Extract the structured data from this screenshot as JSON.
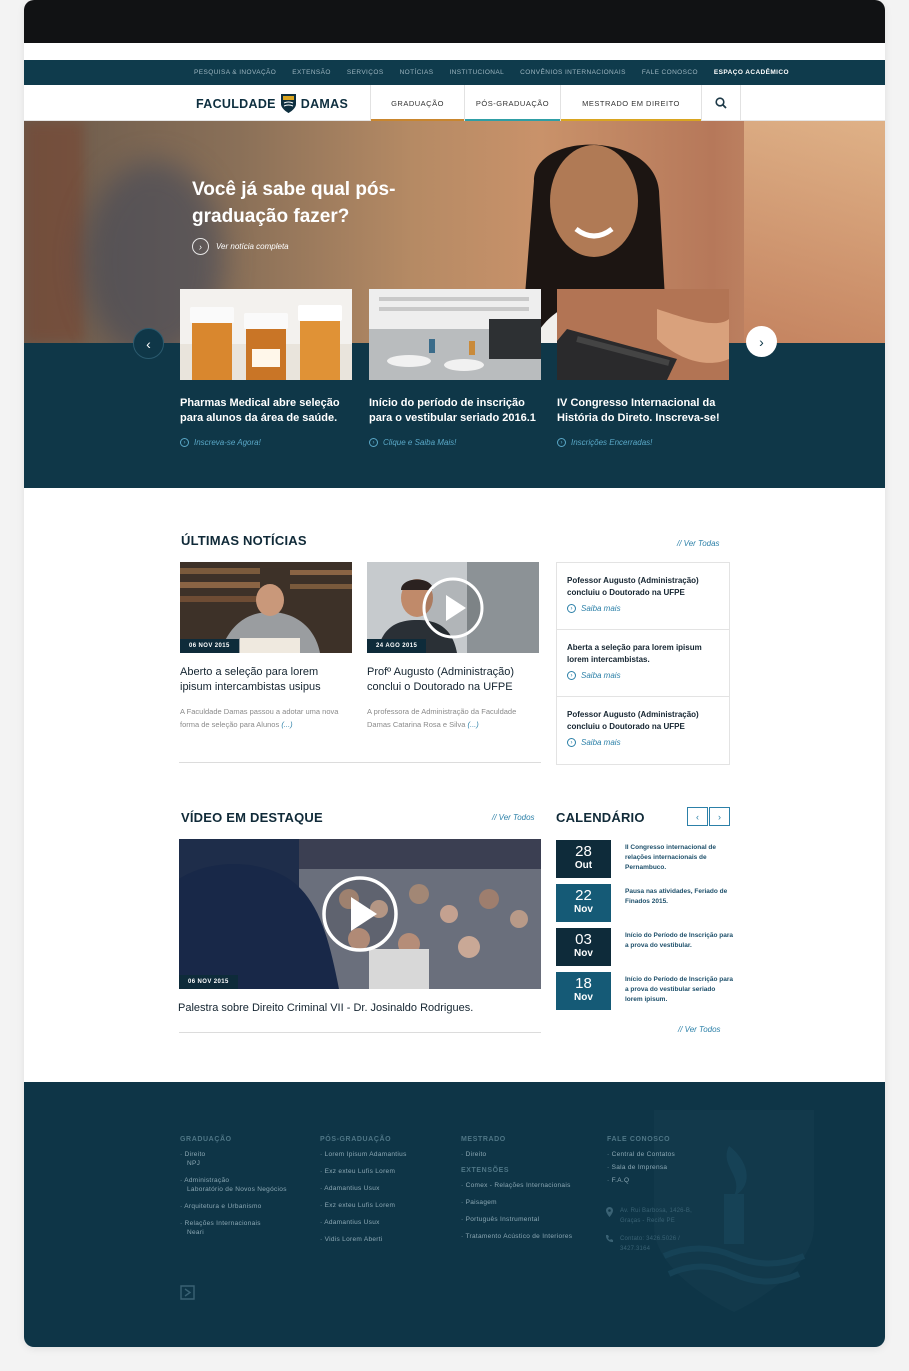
{
  "util_nav": [
    "Pesquisa & Inovação",
    "Extensão",
    "Serviços",
    "Notícias",
    "Institucional",
    "Convênios Internacionais",
    "Fale Conosco",
    "Espaço Acadêmico"
  ],
  "logo": {
    "left": "FACULDADE",
    "right": "DAMAS"
  },
  "main_nav": [
    {
      "label": "Graduação",
      "color": "#c9862e"
    },
    {
      "label": "Pós-Graduação",
      "color": "#2f9fa6"
    },
    {
      "label": "Mestrado em Direito",
      "color": "#d9a520"
    }
  ],
  "hero": {
    "title": "Você já sabe qual pós-graduação fazer?",
    "link": "Ver notícia completa"
  },
  "featured": [
    {
      "title": "Pharmas Medical abre seleção para alunos da área de saúde.",
      "link": "Inscreva-se Agora!"
    },
    {
      "title": "Início do período de inscrição para o vestibular seriado 2016.1",
      "link": "Clique e Saiba Mais!"
    },
    {
      "title": "IV Congresso Internacional da História do Direto. Inscreva-se!",
      "link": "Inscrições Encerradas!"
    }
  ],
  "latest": {
    "title": "ÚLTIMAS NOTÍCIAS",
    "see_all": "// Ver Todas",
    "items": [
      {
        "date": "06 NOV 2015",
        "title": "Aberto a seleção para lorem ipisum intercambistas usipus",
        "desc": "A Faculdade Damas passou a adotar uma nova forma de seleção para Alunos",
        "more": "(...)"
      },
      {
        "date": "24 AGO 2015",
        "title": "Profº Augusto (Administração) conclui o Doutorado na UFPE",
        "desc": "A professora de Administração da Faculdade Damas Catarina Rosa e Silva",
        "more": "(...)"
      }
    ],
    "side": [
      {
        "title": "Pofessor Augusto (Administração) concluiu o Doutorado na UFPE",
        "link": "Saiba mais"
      },
      {
        "title": "Aberta a seleção para lorem ipisum lorem intercambistas.",
        "link": "Saiba mais"
      },
      {
        "title": "Pofessor Augusto (Administração) concluiu o Doutorado na UFPE",
        "link": "Saiba mais"
      }
    ]
  },
  "video": {
    "title": "VÍDEO EM DESTAQUE",
    "see_all": "// Ver Todos",
    "date": "06 NOV 2015",
    "caption": "Palestra sobre Direito Criminal VII - Dr. Josinaldo Rodrigues."
  },
  "calendar": {
    "title": "CALENDÁRIO",
    "prev": "‹",
    "next": "›",
    "see_all": "// Ver Todos",
    "items": [
      {
        "day": "28",
        "month": "Out",
        "text": "II Congresso internacional de relações internacionais de Pernambuco.",
        "color": "#0e2b3a"
      },
      {
        "day": "22",
        "month": "Nov",
        "text": "Pausa nas atividades, Feriado de Finados 2015.",
        "color": "#155a76"
      },
      {
        "day": "03",
        "month": "Nov",
        "text": "Início do Período de Inscrição para a prova do vestibular.",
        "color": "#0e2b3a"
      },
      {
        "day": "18",
        "month": "Nov",
        "text": "Início do Período de Inscrição para a prova do vestibular seriado lorem ipisum.",
        "color": "#155a76"
      }
    ]
  },
  "footer": {
    "graduacao": {
      "title": "Graduação",
      "items": [
        {
          "label": "Direito",
          "sub": "NPJ"
        },
        {
          "label": "Administração",
          "sub": "Laboratório de Novos Negócios"
        },
        {
          "label": "Arquitetura e Urbanismo",
          "sub": ""
        },
        {
          "label": "Relações Internacionais",
          "sub": "Neari"
        }
      ]
    },
    "pos": {
      "title": "Pós-Graduação",
      "items": [
        "Lorem Ipisum Adamantius",
        "Exz exteu Lufis Lorem",
        "Adamantius Usux",
        "Exz exteu Lufis Lorem",
        "Adamantius Usux",
        "Vidis Lorem Aberti"
      ]
    },
    "mestrado": {
      "title": "Mestrado",
      "items": [
        "Direito"
      ]
    },
    "extensoes": {
      "title": "Extensões",
      "items": [
        "Comex - Relações Internacionais",
        "Paisagem",
        "Português Instrumental",
        "Tratamento Acústico de Interiores"
      ]
    },
    "fale": {
      "title": "Fale Conosco",
      "items": [
        "Central de Contatos",
        "Sala de Imprensa",
        "F.A.Q"
      ]
    },
    "address": "Av. Rui Barbosa, 1426-B, Graças - Recife PE",
    "contact": "Contato: 3426.5026 / 3427.3164"
  }
}
